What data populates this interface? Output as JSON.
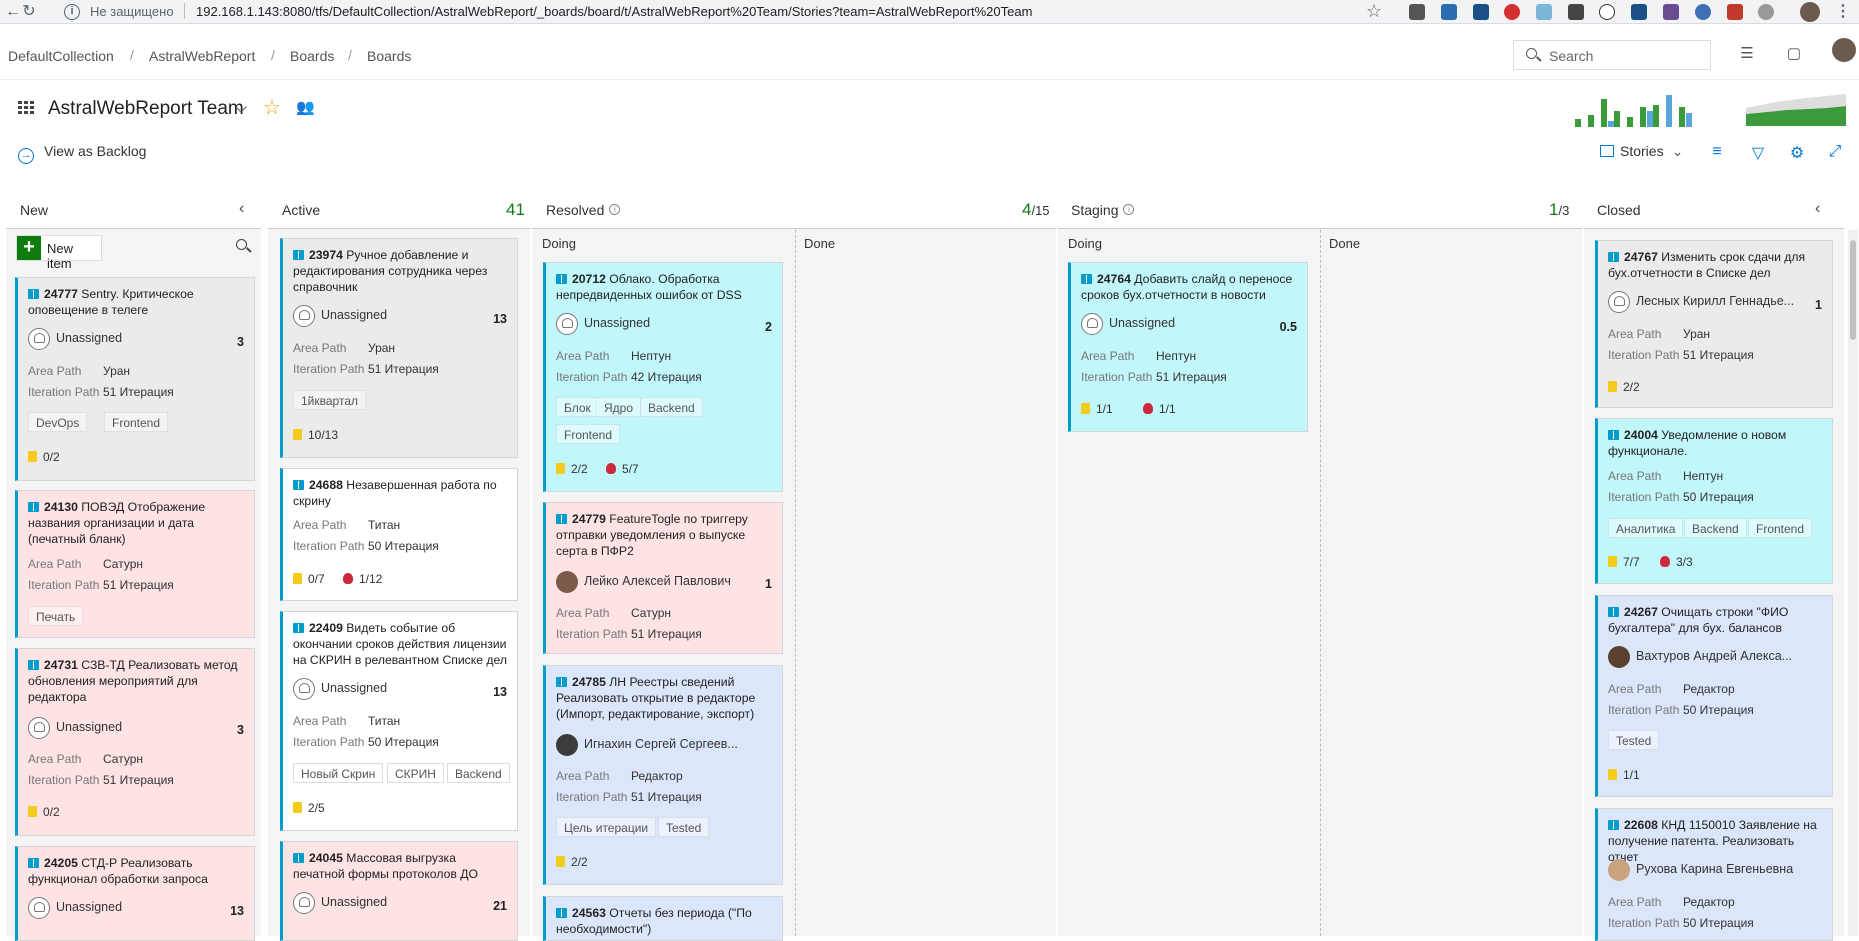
{
  "browser": {
    "not_secure": "Не защищено",
    "url": "192.168.1.143:8080/tfs/DefaultCollection/AstralWebReport/_boards/board/t/AstralWebReport%20Team/Stories?team=AstralWebReport%20Team"
  },
  "breadcrumb": [
    "DefaultCollection",
    "AstralWebReport",
    "Boards",
    "Boards"
  ],
  "search": {
    "placeholder": "Search"
  },
  "team": {
    "title": "AstralWebReport Team",
    "view_backlog": "View as Backlog"
  },
  "toolbar": {
    "level": "Stories"
  },
  "columns": {
    "new": {
      "name": "New"
    },
    "active": {
      "name": "Active",
      "count": "41"
    },
    "resolved": {
      "name": "Resolved",
      "count": "4",
      "limit": "/15",
      "doing": "Doing",
      "done": "Done"
    },
    "staging": {
      "name": "Staging",
      "count": "1",
      "limit": "/3",
      "doing": "Doing",
      "done": "Done"
    },
    "closed": {
      "name": "Closed"
    }
  },
  "new_item": "New item",
  "labels": {
    "area": "Area Path",
    "iteration": "Iteration Path",
    "unassigned": "Unassigned"
  },
  "cards": {
    "c24777": {
      "id": "24777",
      "title": "Sentry. Критическое оповещение в телеге",
      "assignee": "Unassigned",
      "points": "3",
      "area": "Уран",
      "iteration": "51 Итерация",
      "tags": [
        "DevOps",
        "Frontend"
      ],
      "tasks": "0/2"
    },
    "c24130": {
      "id": "24130",
      "title": "ПОВЭД Отображение названия организации и дата (печатный бланк)",
      "area": "Сатурн",
      "iteration": "51 Итерация",
      "tags": [
        "Печать"
      ]
    },
    "c24731": {
      "id": "24731",
      "title": "СЗВ-ТД Реализовать метод обновления мероприятий для редактора",
      "assignee": "Unassigned",
      "points": "3",
      "area": "Сатурн",
      "iteration": "51 Итерация",
      "tasks": "0/2"
    },
    "c24205": {
      "id": "24205",
      "title": "СТД-Р Реализовать функционал обработки запроса",
      "assignee": "Unassigned",
      "points": "13"
    },
    "c23974": {
      "id": "23974",
      "title": "Ручное добавление и редактирования сотрудника через справочник",
      "assignee": "Unassigned",
      "points": "13",
      "area": "Уран",
      "iteration": "51 Итерация",
      "tags": [
        "1йквартал"
      ],
      "tasks": "10/13"
    },
    "c24688": {
      "id": "24688",
      "title": "Незавершенная работа по скрину",
      "area": "Титан",
      "iteration": "50 Итерация",
      "tasks": "0/7",
      "bugs": "1/12"
    },
    "c22409": {
      "id": "22409",
      "title": "Видеть событие об окончании сроков действия лицензии на СКРИН в релевантном Списке дел",
      "assignee": "Unassigned",
      "points": "13",
      "area": "Титан",
      "iteration": "50 Итерация",
      "tags": [
        "Новый Скрин",
        "СКРИН",
        "Backend"
      ],
      "tasks": "2/5"
    },
    "c24045": {
      "id": "24045",
      "title": "Массовая выгрузка печатной формы протоколов ДО",
      "assignee": "Unassigned",
      "points": "21"
    },
    "c20712": {
      "id": "20712",
      "title": "Облако. Обработка непредвиденных ошибок от DSS",
      "assignee": "Unassigned",
      "points": "2",
      "area": "Нептун",
      "iteration": "42 Итерация",
      "tags": [
        "Блок",
        "Ядро",
        "Backend",
        "Frontend"
      ],
      "tasks": "2/2",
      "bugs": "5/7"
    },
    "c24779": {
      "id": "24779",
      "title": "FeatureTogle по триггеру отправки уведомления о выпуске серта в ПФР2",
      "assignee": "Лейко Алексей Павлович",
      "points": "1",
      "area": "Сатурн",
      "iteration": "51 Итерация"
    },
    "c24785": {
      "id": "24785",
      "title": "ЛН Реестры сведений Реализовать открытие в редакторе (Импорт, редактирование, экспорт)",
      "assignee": "Игнахин Сергей Сергеев...",
      "area": "Редактор",
      "iteration": "51 Итерация",
      "tags": [
        "Цель итерации",
        "Tested"
      ],
      "tasks": "2/2"
    },
    "c24563": {
      "id": "24563",
      "title": "Отчеты без периода (\"По необходимости\")"
    },
    "c24764": {
      "id": "24764",
      "title": "Добавить слайд о переносе сроков бух.отчетности в новости",
      "assignee": "Unassigned",
      "points": "0.5",
      "area": "Нептун",
      "iteration": "51 Итерация",
      "tasks": "1/1",
      "bugs": "1/1"
    },
    "c24767": {
      "id": "24767",
      "title": "Изменить срок сдачи для бух.отчетности в Списке дел",
      "assignee": "Лесных Кирилл Геннадье...",
      "points": "1",
      "area": "Уран",
      "iteration": "51 Итерация",
      "tasks": "2/2"
    },
    "c24004": {
      "id": "24004",
      "title": "Уведомление о новом функционале.",
      "area": "Нептун",
      "iteration": "50 Итерация",
      "tags": [
        "Аналитика",
        "Backend",
        "Frontend"
      ],
      "tasks": "7/7",
      "bugs": "3/3"
    },
    "c24267": {
      "id": "24267",
      "title": "Очищать строки \"ФИО бухгалтера\" для бух. балансов",
      "assignee": "Вахтуров Андрей Алекса...",
      "area": "Редактор",
      "iteration": "50 Итерация",
      "tags": [
        "Tested"
      ],
      "tasks": "1/1"
    },
    "c22608": {
      "id": "22608",
      "title": "КНД 1150010 Заявление на получение патента. Реализовать отчет",
      "assignee": "Рухова Карина Евгеньевна",
      "area": "Редактор",
      "iteration": "50 Итерация"
    }
  },
  "colors": {
    "accent": "#0078d4",
    "story": "#009ccc",
    "green": "#107c10"
  }
}
